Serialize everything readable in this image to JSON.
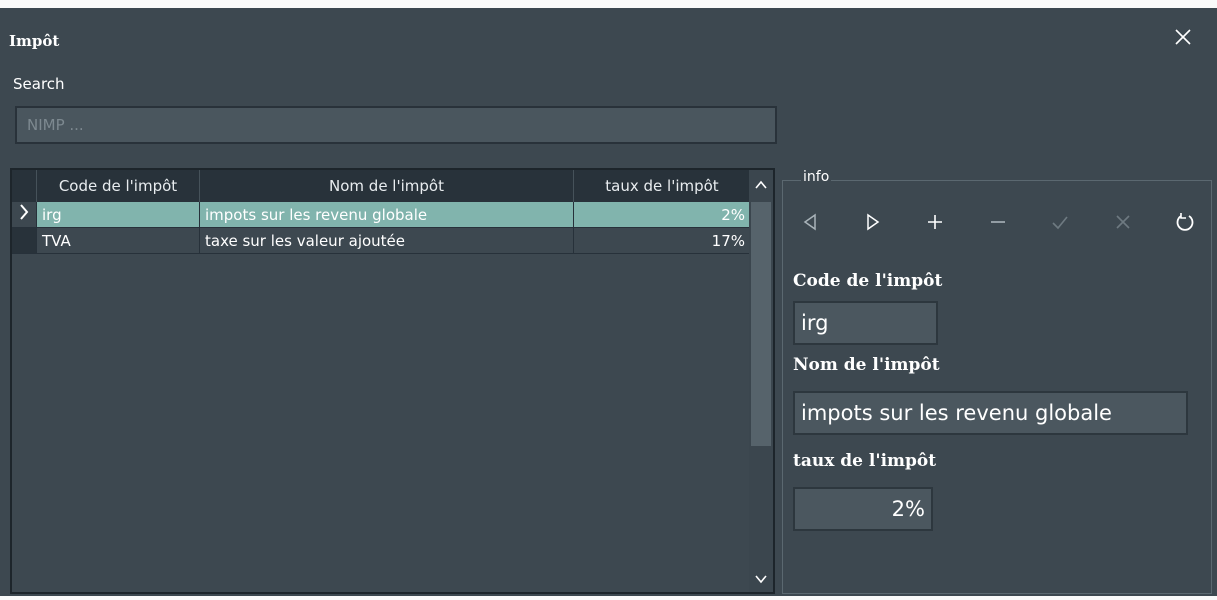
{
  "window": {
    "title": "Impôt",
    "close_icon": "close-icon"
  },
  "search": {
    "label": "Search",
    "placeholder": "NIMP ..."
  },
  "grid": {
    "columns": [
      "Code de l'impôt",
      "Nom de l'impôt",
      "taux de l'impôt"
    ],
    "rows": [
      {
        "code": "irg",
        "nom": "impots sur les revenu globale",
        "taux": "2%"
      },
      {
        "code": "TVA",
        "nom": "taxe sur les valeur ajoutée",
        "taux": "17%"
      }
    ],
    "selected_row": 0,
    "scrollbar_icons": [
      "chevron-up-icon",
      "chevron-down-icon"
    ]
  },
  "info": {
    "legend": "info",
    "nav_icons": [
      "prev-icon",
      "next-icon",
      "plus-icon",
      "minus-icon",
      "check-icon",
      "cancel-icon",
      "refresh-icon"
    ],
    "fields": {
      "code_label": "Code de l'impôt",
      "code_value": "irg",
      "nom_label": "Nom de l'impôt",
      "nom_value": "impots sur les revenu globale",
      "taux_label": "taux de l'impôt",
      "taux_value": "2%"
    }
  },
  "colors": {
    "background": "#3d4850",
    "header": "#28323a",
    "selected_row": "#81b4ad",
    "input": "#4b575f"
  }
}
